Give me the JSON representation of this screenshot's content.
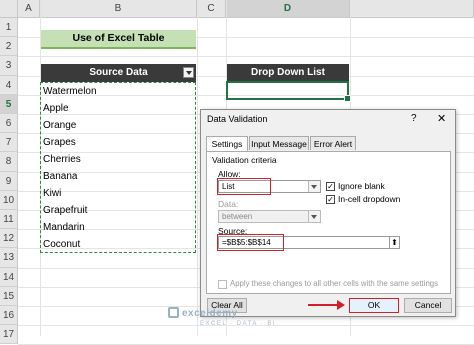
{
  "columns": [
    "A",
    "B",
    "C",
    "D"
  ],
  "rows": [
    "1",
    "2",
    "3",
    "4",
    "5",
    "6",
    "7",
    "8",
    "9",
    "10",
    "11",
    "12",
    "13",
    "14",
    "15",
    "16",
    "17"
  ],
  "title_cell": "Use of Excel Table",
  "source_header": "Source Data",
  "drop_down_header": "Drop Down List",
  "fruits": [
    "Watermelon",
    "Apple",
    "Orange",
    "Grapes",
    "Cherries",
    "Banana",
    "Kiwi",
    "Grapefruit",
    "Mandarin",
    "Coconut"
  ],
  "dialog": {
    "title": "Data Validation",
    "help": "?",
    "close": "✕",
    "tabs": [
      "Settings",
      "Input Message",
      "Error Alert"
    ],
    "section": "Validation criteria",
    "allow_label": "Allow:",
    "allow_value": "List",
    "data_label": "Data:",
    "data_value": "between",
    "ignore_blank": "Ignore blank",
    "in_cell_dropdown": "In-cell dropdown",
    "source_label": "Source:",
    "source_value": "=$B$5:$B$14",
    "apply_all": "Apply these changes to all other cells with the same settings",
    "clear_all": "Clear All",
    "ok": "OK",
    "cancel": "Cancel"
  },
  "watermark": "exceldemy",
  "watermark_sub": "EXCEL · DATA · BI",
  "colors": {
    "accent": "#217346",
    "title_bg": "#c5e0b4",
    "header_bg": "#3a3a3a",
    "highlight": "#d0202a"
  }
}
